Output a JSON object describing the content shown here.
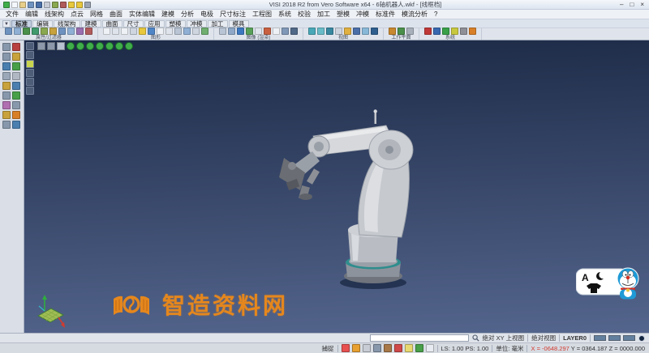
{
  "window": {
    "title": "VISI 2018 R2 from Vero Software x64 - 6轴机器人.wkf - [线框档]",
    "minimize": "–",
    "maximize": "□",
    "close": "×"
  },
  "quick_access": {
    "icons": [
      {
        "n": "app-logo",
        "c": "#3fae4a"
      },
      {
        "n": "new-file",
        "c": "#f4f7fb"
      },
      {
        "n": "open-file",
        "c": "#e8cf8a"
      },
      {
        "n": "save-file",
        "c": "#6f93c0"
      },
      {
        "n": "save-all",
        "c": "#4a6fa8"
      },
      {
        "n": "print",
        "c": "#c7ccd6"
      },
      {
        "n": "plot",
        "c": "#8aa84f"
      },
      {
        "n": "delete",
        "c": "#b05b5b"
      },
      {
        "n": "undo",
        "c": "#e8c83c"
      },
      {
        "n": "redo",
        "c": "#e8c83c"
      },
      {
        "n": "qat-dropdown",
        "c": "#9aa4b2"
      }
    ]
  },
  "menu": {
    "items": [
      "文件",
      "编辑",
      "线架构",
      "点云",
      "网格",
      "曲面",
      "实体编辑",
      "建模",
      "分析",
      "电极",
      "尺寸标注",
      "工程图",
      "系统",
      "校验",
      "加工",
      "塑模",
      "冲模",
      "标准件",
      "模流分析",
      "?"
    ]
  },
  "tabs": {
    "dropdown": "▼",
    "items": [
      {
        "label": "标准",
        "selected": true
      },
      {
        "label": "编辑",
        "selected": false
      },
      {
        "label": "线架构",
        "selected": false
      },
      {
        "label": "建模",
        "selected": false
      },
      {
        "label": "曲面",
        "selected": false
      },
      {
        "label": "尺寸",
        "selected": false
      },
      {
        "label": "应用",
        "selected": false
      },
      {
        "label": "塑模",
        "selected": false
      },
      {
        "label": "冲模",
        "selected": false
      },
      {
        "label": "加工",
        "selected": false
      },
      {
        "label": "模具",
        "selected": false
      }
    ]
  },
  "toolbar": {
    "groups": [
      {
        "label": "属性/过滤器",
        "icons": [
          {
            "n": "element-properties",
            "c": "#6f93c0"
          },
          {
            "n": "layer-filter",
            "c": "#8fb0d4"
          },
          {
            "n": "color-filter",
            "c": "#4a8f4a"
          },
          {
            "n": "type-filter",
            "c": "#3f9a6e"
          },
          {
            "n": "select-all",
            "c": "#8aa84f"
          },
          {
            "n": "select-box",
            "c": "#c8a23c"
          },
          {
            "n": "attribute-copy",
            "c": "#6f93c0"
          },
          {
            "n": "attribute-paste",
            "c": "#8fb0d4"
          },
          {
            "n": "group",
            "c": "#9a6fb0"
          },
          {
            "n": "ungroup",
            "c": "#b05b5b"
          }
        ]
      },
      {
        "label": "图形",
        "icons": [
          {
            "n": "wireframe-view",
            "c": "#eef1f6"
          },
          {
            "n": "shaded-view",
            "c": "#dfe4ec"
          },
          {
            "n": "hidden-line",
            "c": "#eef1f6"
          },
          {
            "n": "ghost-view",
            "c": "#cfd6e0"
          },
          {
            "n": "highlight-edges",
            "c": "#e8c83c"
          },
          {
            "n": "active-layer",
            "c": "#4f86c8"
          },
          {
            "n": "show-points",
            "c": "#eef1f6"
          },
          {
            "n": "show-axes",
            "c": "#dfe4ec"
          },
          {
            "n": "show-grid",
            "c": "#b9c4d4"
          },
          {
            "n": "show-planes",
            "c": "#8fb0d4"
          },
          {
            "n": "show-labels",
            "c": "#cfd6e0"
          },
          {
            "n": "refresh-graphics",
            "c": "#6fae6f"
          }
        ]
      },
      {
        "label": "图像 (渲染)",
        "icons": [
          {
            "n": "render-shaded",
            "c": "#b9c4d4"
          },
          {
            "n": "render-materials",
            "c": "#8fa8c8"
          },
          {
            "n": "render-blue",
            "c": "#3c78c0"
          },
          {
            "n": "render-green",
            "c": "#58a058"
          },
          {
            "n": "render-flat",
            "c": "#dfe4ec"
          },
          {
            "n": "render-copper",
            "c": "#c86040"
          },
          {
            "n": "render-white",
            "c": "#eef1f6"
          },
          {
            "n": "render-steel",
            "c": "#8098b8"
          },
          {
            "n": "render-dark",
            "c": "#506888"
          }
        ]
      },
      {
        "label": "视图",
        "icons": [
          {
            "n": "zoom-all",
            "c": "#48a8b8"
          },
          {
            "n": "zoom-window",
            "c": "#68bcc8"
          },
          {
            "n": "zoom-previous",
            "c": "#3888a0"
          },
          {
            "n": "pan-view",
            "c": "#cdd4de"
          },
          {
            "n": "iso-view",
            "c": "#e0b040"
          },
          {
            "n": "top-view",
            "c": "#4a6fa8"
          },
          {
            "n": "front-view",
            "c": "#88b8d8"
          },
          {
            "n": "rotate-view",
            "c": "#2f5f8f"
          }
        ]
      },
      {
        "label": "工作平面",
        "icons": [
          {
            "n": "workplane-new",
            "c": "#c8882f"
          },
          {
            "n": "workplane-align",
            "c": "#4a8f4a"
          },
          {
            "n": "workplane-reset",
            "c": "#a8b0bc"
          }
        ]
      },
      {
        "label": "系统",
        "icons": [
          {
            "n": "system-settings",
            "c": "#c03838"
          },
          {
            "n": "system-database",
            "c": "#3868b0"
          },
          {
            "n": "system-check",
            "c": "#38a048"
          },
          {
            "n": "system-tools",
            "c": "#c8c83f"
          },
          {
            "n": "system-info",
            "c": "#8f8f97"
          },
          {
            "n": "system-exit",
            "c": "#d87f28"
          }
        ]
      }
    ]
  },
  "left_palette": {
    "icons": [
      {
        "n": "select",
        "c": "#8898ac"
      },
      {
        "n": "select-red",
        "c": "#b84040"
      },
      {
        "n": "snap-end",
        "c": "#8898ac"
      },
      {
        "n": "snap-mid",
        "c": "#c8a23c"
      },
      {
        "n": "snap-center",
        "c": "#4a7fb0"
      },
      {
        "n": "snap-intersect",
        "c": "#48a048"
      },
      {
        "n": "snap-point",
        "c": "#9aa8b8"
      },
      {
        "n": "snap-grid",
        "c": "#b0b8c4"
      },
      {
        "n": "snap-quad",
        "c": "#c8a23c"
      },
      {
        "n": "snap-tangent",
        "c": "#4a7fb0"
      },
      {
        "n": "snap-perp",
        "c": "#8898ac"
      },
      {
        "n": "snap-parallel",
        "c": "#48a048"
      },
      {
        "n": "snap-node",
        "c": "#b06fb0"
      },
      {
        "n": "snap-near",
        "c": "#8898ac"
      },
      {
        "n": "snap-angle",
        "c": "#c8a23c"
      },
      {
        "n": "snap-free",
        "c": "#d87f28"
      },
      {
        "n": "snap-lock",
        "c": "#8898ac"
      },
      {
        "n": "snap-auto",
        "c": "#4a7fb0"
      }
    ]
  },
  "viewport": {
    "background_top": "#1c2a46",
    "background_bottom": "#54658d",
    "view_strip": [
      {
        "n": "viewport-single",
        "c": "#4e5d78"
      },
      {
        "n": "viewport-split",
        "c": "#4e5d78"
      },
      {
        "n": "viewport-active",
        "c": "#c9d44e"
      },
      {
        "n": "viewport-quad",
        "c": "#4e5d78"
      },
      {
        "n": "viewport-list",
        "c": "#4e5d78"
      },
      {
        "n": "viewport-config",
        "c": "#4e5d78"
      }
    ],
    "top_icons": [
      {
        "n": "view-mode",
        "c": "#8d99aa"
      },
      {
        "n": "view-lock",
        "c": "#8d99aa"
      },
      {
        "n": "view-cursor",
        "c": "#b8c2d0"
      },
      {
        "n": "orbit-free",
        "c": "#3fae4a",
        "s": "c"
      },
      {
        "n": "orbit-x",
        "c": "#3fae4a",
        "s": "c"
      },
      {
        "n": "orbit-y",
        "c": "#3fae4a",
        "s": "c"
      },
      {
        "n": "orbit-z",
        "c": "#3fae4a",
        "s": "c"
      },
      {
        "n": "orbit-iso",
        "c": "#3fae4a",
        "s": "c"
      },
      {
        "n": "orbit-top",
        "c": "#3fae4a",
        "s": "c"
      },
      {
        "n": "orbit-front",
        "c": "#3fae4a",
        "s": "c"
      }
    ],
    "watermark": {
      "text": "智造资料网",
      "color": "#ee8a18"
    }
  },
  "command_bar": {
    "input_value": "",
    "view_label": "绝对 XY 上视图",
    "coord_label": "绝对视图",
    "layer_label": "LAYER0",
    "swatches": [
      {
        "n": "color-swatch-1",
        "c": "#64809f"
      },
      {
        "n": "color-swatch-2",
        "c": "#64809f"
      },
      {
        "n": "color-swatch-3",
        "c": "#64809f"
      }
    ]
  },
  "status_bar": {
    "snap_label": "捕捉",
    "icons": [
      {
        "n": "snap-settings",
        "c": "#e85050"
      },
      {
        "n": "snap-magnet",
        "c": "#e8a030"
      },
      {
        "n": "snap-grid-toggle",
        "c": "#c8ccd4"
      },
      {
        "n": "snap-entity",
        "c": "#8898ac"
      },
      {
        "n": "snap-move",
        "c": "#a87848"
      },
      {
        "n": "snap-anchor",
        "c": "#d04848"
      },
      {
        "n": "snap-light",
        "c": "#e8d870"
      },
      {
        "n": "snap-timer",
        "c": "#48a048"
      },
      {
        "n": "snap-crosshair",
        "c": "#e8ecf2"
      }
    ],
    "scale_label": "LS: 1.00 PS: 1.00",
    "units_label": "单位: 毫米",
    "coords": {
      "x": "X = -0648.297",
      "y": "Y = 0364.187",
      "z": "Z = 0000.000",
      "x_color": "#d23a2e"
    }
  }
}
